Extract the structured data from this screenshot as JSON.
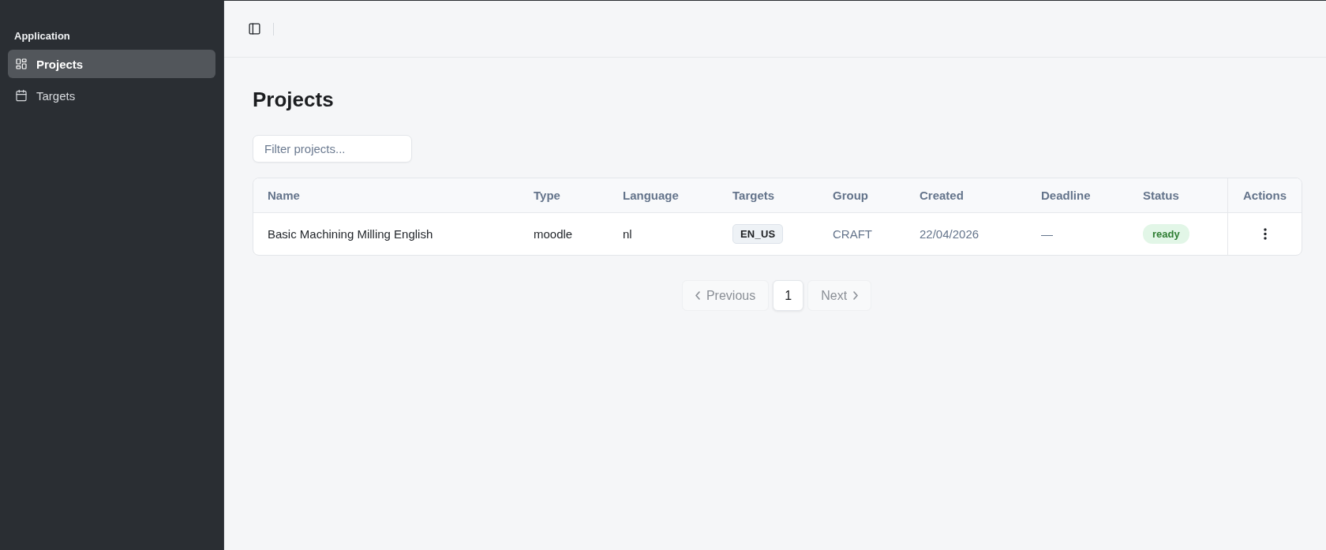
{
  "sidebar": {
    "group_label": "Application",
    "items": [
      {
        "label": "Projects",
        "selected": true
      },
      {
        "label": "Targets",
        "selected": false
      }
    ]
  },
  "page": {
    "title": "Projects"
  },
  "filter": {
    "placeholder": "Filter projects..."
  },
  "table": {
    "columns": [
      "Name",
      "Type",
      "Language",
      "Targets",
      "Group",
      "Created",
      "Deadline",
      "Status",
      "Actions"
    ],
    "rows": [
      {
        "name": "Basic Machining Milling English",
        "type": "moodle",
        "language": "nl",
        "targets": [
          "EN_US"
        ],
        "group": "CRAFT",
        "created": "22/04/2026",
        "deadline": "—",
        "status": "ready"
      }
    ]
  },
  "pagination": {
    "previous": {
      "label": "Previous",
      "disabled": true
    },
    "pages": [
      {
        "label": "1",
        "selected": true
      }
    ],
    "next": {
      "label": "Next",
      "disabled": true
    }
  }
}
